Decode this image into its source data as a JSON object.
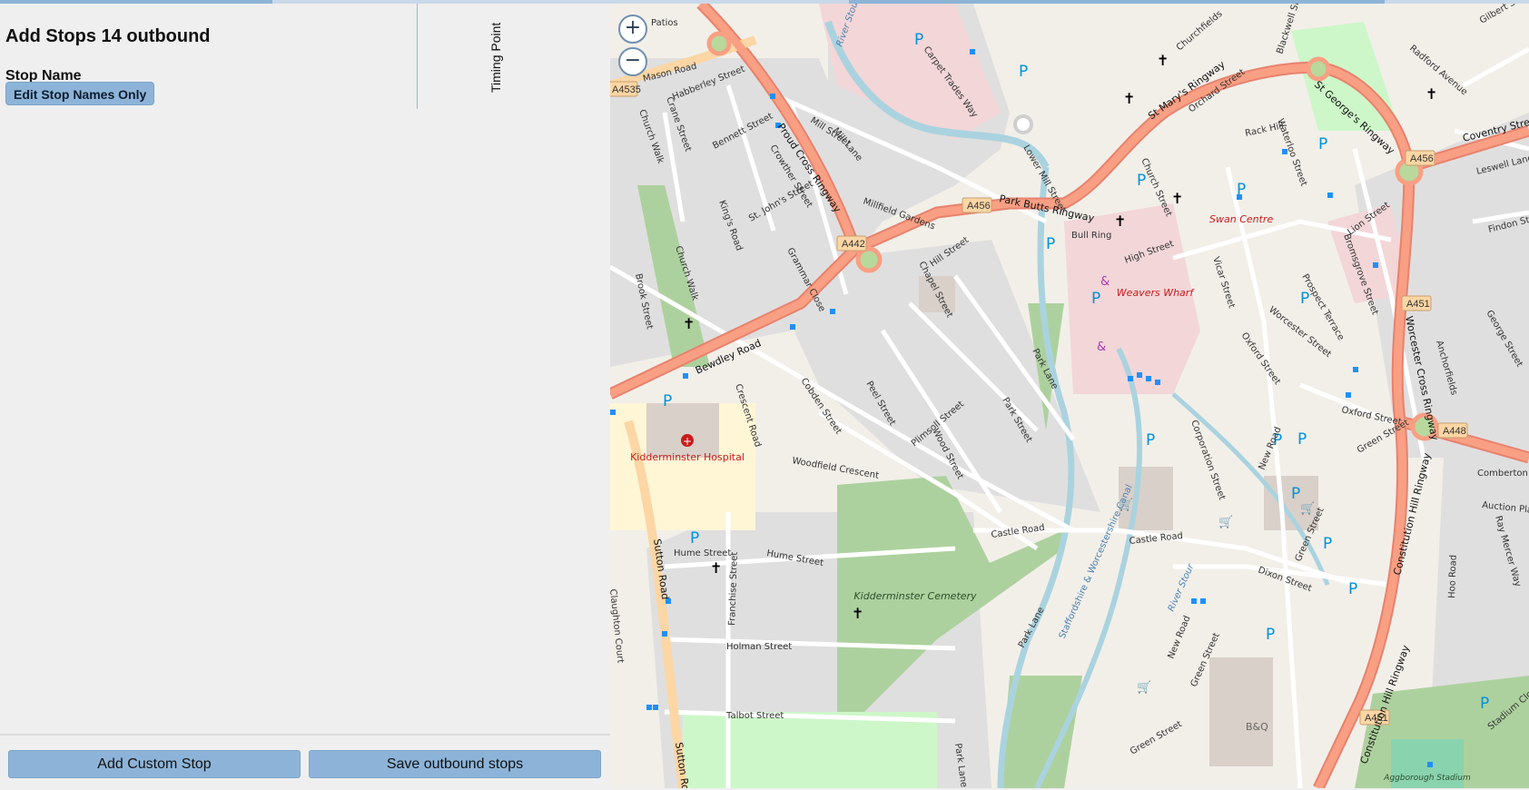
{
  "panel": {
    "title": "Add Stops 14 outbound",
    "stop_name_label": "Stop Name",
    "edit_button": "Edit Stop Names Only",
    "timing_point_label": "Timing Point"
  },
  "footer": {
    "add_custom": "Add Custom Stop",
    "save": "Save outbound stops"
  },
  "map": {
    "zoom_in": "+",
    "zoom_out": "−",
    "roads": {
      "a4535": "A4535",
      "a442": "A442",
      "a456_1": "A456",
      "a456_2": "A456",
      "a451": "A451",
      "a448": "A448",
      "a451_2": "A451",
      "mason": "Mason Road",
      "proud": "Proud Cross Ringway",
      "bewdley": "Bewdley Road",
      "parkbutts": "Park Butts Ringway",
      "stmarys": "St Mary's Ringway",
      "stgeorges": "St George's Ringway",
      "worcester": "Worcester Cross Ringway",
      "constitution": "Constitution Hill Ringway",
      "coventry": "Coventry Street",
      "sutton": "Sutton Road",
      "woodfield": "Woodfield Crescent",
      "castle": "Castle Road",
      "castle2": "Castle Road",
      "hume": "Hume Street",
      "hume2": "Hume Street",
      "holman": "Holman Street",
      "talbot": "Talbot Street",
      "franchise": "Franchise Street",
      "crescent": "Crescent Road",
      "cobden": "Cobden Street",
      "peel": "Peel Street",
      "plimsoll": "Plimsoll Street",
      "wood": "Wood Street",
      "parkst": "Park Street",
      "parklane": "Park Lane",
      "parklane2": "Park Lane",
      "parklane3": "Park Lane",
      "millst": "Mill Street",
      "milllane": "Mill Lane",
      "millfield": "Millfield Gardens",
      "lowermill": "Lower Mill Street",
      "carpet": "Carpet Trades Way",
      "habberley": "Habberley Street",
      "bennett": "Bennett Street",
      "crane": "Crane Street",
      "crowther": "Crowther Street",
      "stjohns": "St. John's Street",
      "kings": "King's Road",
      "churchwalk": "Church Walk",
      "churchwalk2": "Church Walk",
      "brook": "Brook Street",
      "grammar": "Grammar Close",
      "hill": "Hill Street",
      "chapel": "Chapel Street",
      "bullring": "Bull Ring",
      "high": "High Street",
      "vicar": "Vicar Street",
      "oxford": "Oxford Street",
      "oxford2": "Oxford Street",
      "worcesterst": "Worcester Street",
      "corporation": "Corporation Street",
      "newroad": "New Road",
      "newroad2": "New Road",
      "green": "Green Street",
      "green2": "Green Street",
      "green3": "Green Street",
      "dixon": "Dixon Street",
      "churchst": "Church Street",
      "churchfields": "Churchfields",
      "orchard": "Orchard Street",
      "rackhill": "Rack Hill",
      "waterloo": "Waterloo Street",
      "blackwell": "Blackwell St",
      "leswell": "Leswell Lane",
      "lion": "Lion Street",
      "bromsgrove": "Bromsgrove Street",
      "prospect": "Prospect Terrace",
      "findon": "Findon Street",
      "george": "George Street",
      "anchorfields": "Anchorfields",
      "radford": "Radford Avenue",
      "gilbert": "Gilbert Scott",
      "comberton": "Comberton",
      "auction": "Auction Place",
      "raymercer": "Ray Mercer Way",
      "hoo": "Hoo Road",
      "stadiumclose": "Stadium Close",
      "claughton": "Claughton Court",
      "patios": "Patios",
      "canal": "Staffordshire & Worcestershire Canal",
      "riverstour1": "River Stour",
      "riverstour2": "River Stour"
    },
    "places": {
      "hospital": "Kidderminster Hospital",
      "cemetery": "Kidderminster Cemetery",
      "weavers": "Weavers Wharf",
      "swan": "Swan Centre",
      "bq": "B&Q",
      "stadium": "Aggborough Stadium"
    }
  }
}
